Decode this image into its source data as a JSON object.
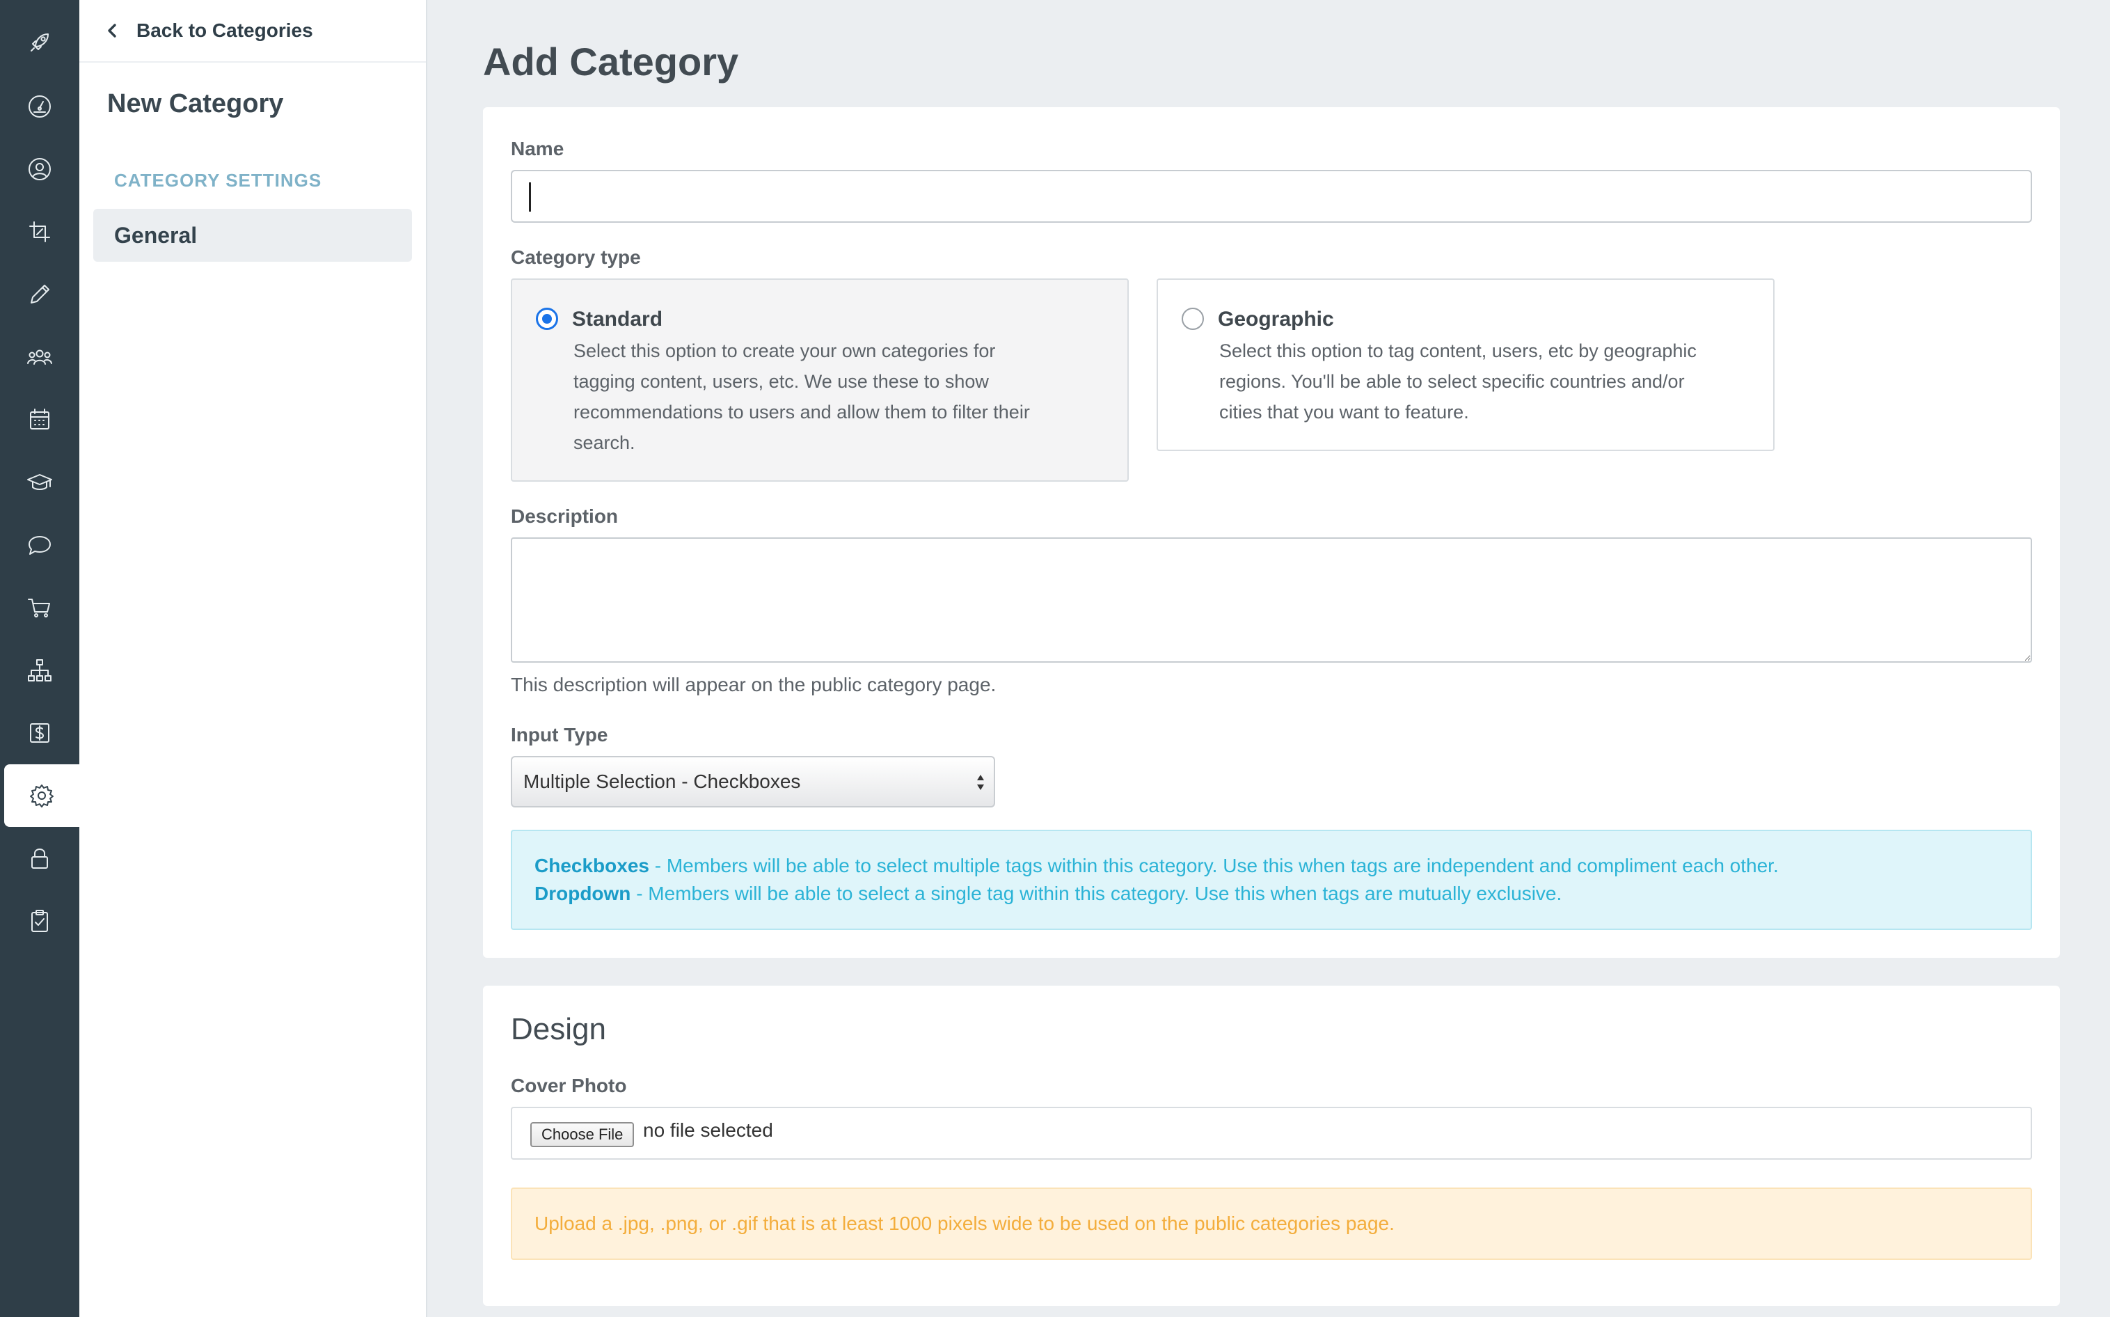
{
  "rail": {
    "items": [
      {
        "icon": "rocket-icon"
      },
      {
        "icon": "dashboard-gauge-icon"
      },
      {
        "icon": "user-circle-icon"
      },
      {
        "icon": "crop-icon"
      },
      {
        "icon": "pencil-icon"
      },
      {
        "icon": "users-group-icon"
      },
      {
        "icon": "calendar-icon"
      },
      {
        "icon": "graduation-cap-icon"
      },
      {
        "icon": "chat-bubble-icon"
      },
      {
        "icon": "shopping-cart-icon"
      },
      {
        "icon": "org-chart-icon"
      },
      {
        "icon": "dollar-icon"
      },
      {
        "icon": "gear-icon",
        "active": true
      },
      {
        "icon": "lock-icon"
      },
      {
        "icon": "clipboard-check-icon"
      }
    ]
  },
  "subnav": {
    "back_label": "Back to Categories",
    "title": "New Category",
    "section_label": "CATEGORY SETTINGS",
    "item_label": "General"
  },
  "page": {
    "title": "Add Category"
  },
  "form": {
    "name_label": "Name",
    "name_value": "",
    "category_type_label": "Category type",
    "types": [
      {
        "title": "Standard",
        "selected": true,
        "desc": [
          "Select this option to create your own categories for",
          "tagging content, users, etc. We use these to show",
          "recommendations to users and allow them to filter their",
          "search."
        ]
      },
      {
        "title": "Geographic",
        "selected": false,
        "desc": [
          "Select this option to tag content, users, etc by geographic",
          "regions. You'll be able to select specific countries and/or",
          "cities that you want to feature."
        ]
      }
    ],
    "description_label": "Description",
    "description_help": "This description will appear on the public category page.",
    "input_type_label": "Input Type",
    "input_type_value": "Multiple Selection - Checkboxes",
    "info": {
      "checkboxes_term": "Checkboxes",
      "checkboxes_text": " - Members will be able to select multiple tags within this category. Use this when tags are independent and compliment each other.",
      "dropdown_term": "Dropdown",
      "dropdown_text": " - Members will be able to select a single tag within this category. Use this when tags are mutually exclusive."
    }
  },
  "design": {
    "title": "Design",
    "cover_photo_label": "Cover Photo",
    "choose_file_label": "Choose File",
    "file_status": "no file selected",
    "upload_hint": "Upload a .jpg, .png, or .gif that is at least 1000 pixels wide to be used on the public categories page."
  },
  "colors": {
    "rail_bg": "#2f3e48",
    "info_text": "#2bb3d6",
    "warning_text": "#f3ad3c",
    "radio_accent": "#1a73e8"
  }
}
